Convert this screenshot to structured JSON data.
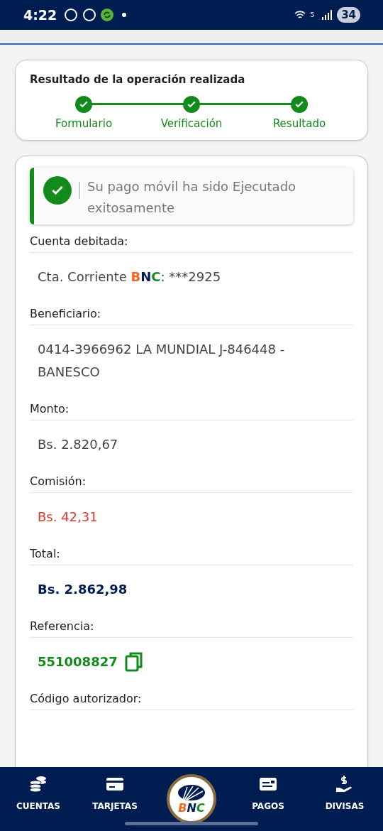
{
  "status_bar": {
    "time": "4:22",
    "wifi_badge": "5",
    "battery": "34"
  },
  "progress": {
    "title": "Resultado de la operación realizada",
    "steps": [
      {
        "label": "Formulario",
        "done": true
      },
      {
        "label": "Verificación",
        "done": true
      },
      {
        "label": "Resultado",
        "done": true
      }
    ]
  },
  "alert": {
    "kind": "success",
    "message": "Su pago móvil ha sido Ejecutado exitosamente"
  },
  "fields": [
    {
      "label": "Cuenta debitada:",
      "kind": "account",
      "value": "Cta. Corriente ",
      "brand": "BNC",
      "suffix": ": ***2925"
    },
    {
      "label": "Beneficiario:",
      "kind": "plain",
      "value": "0414-3966962 LA MUNDIAL J-846448 - BANESCO"
    },
    {
      "label": "Monto:",
      "kind": "plain",
      "value": "Bs. 2.820,67"
    },
    {
      "label": "Comisión:",
      "kind": "negative",
      "value": "Bs. 42,31"
    },
    {
      "label": "Total:",
      "kind": "total",
      "value": "Bs. 2.862,98"
    },
    {
      "label": "Referencia:",
      "kind": "reference",
      "value": "551008827"
    },
    {
      "label": "Código autorizador:",
      "kind": "empty"
    }
  ],
  "nav": {
    "items": [
      {
        "label": "CUENTAS",
        "kind": "coins"
      },
      {
        "label": "TARJETAS",
        "kind": "card"
      },
      {
        "label": "BNC",
        "kind": "logo"
      },
      {
        "label": "PAGOS",
        "kind": "payment"
      },
      {
        "label": "DIVISAS",
        "kind": "hand"
      }
    ]
  }
}
